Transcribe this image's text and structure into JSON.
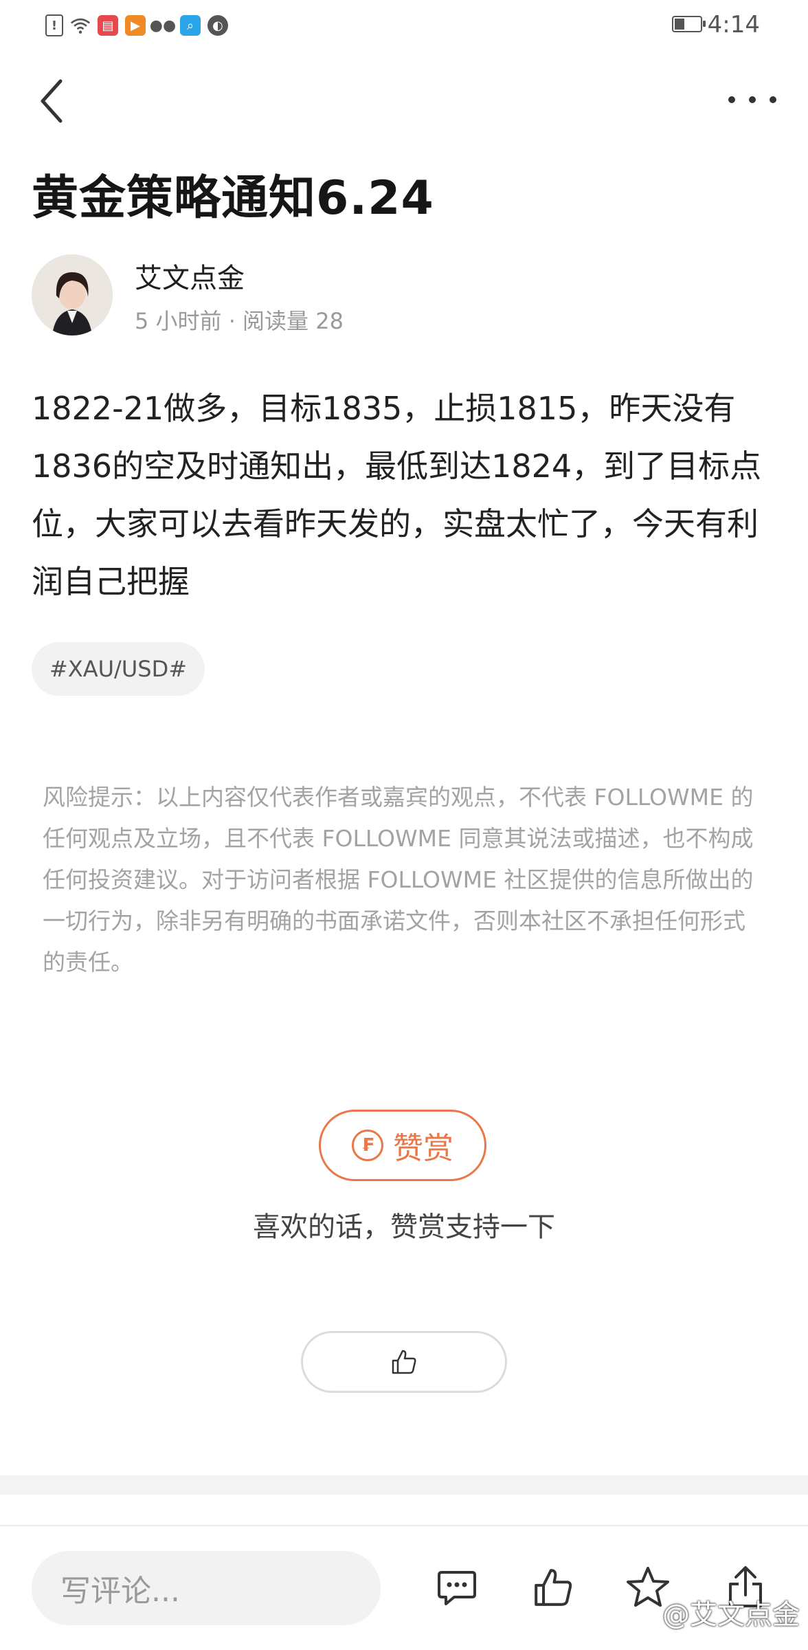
{
  "status_bar": {
    "time": "4:14",
    "icons": [
      "sim-alert-icon",
      "wifi-icon",
      "app-red-icon",
      "video-icon",
      "wechat-icon",
      "search-app-icon",
      "browser-icon"
    ]
  },
  "nav": {
    "back_icon": "chevron-left-icon",
    "more_icon": "more-dots-icon"
  },
  "article": {
    "title": "黄金策略通知6.24",
    "author": {
      "name": "艾文点金",
      "meta": "5 小时前 · 阅读量 28"
    },
    "body": "1822-21做多，目标1835，止损1815，昨天没有1836的空及时通知出，最低到达1824，到了目标点位，大家可以去看昨天发的，实盘太忙了，今天有利润自己把握",
    "tag": "#XAU/USD#",
    "disclaimer": "风险提示：以上内容仅代表作者或嘉宾的观点，不代表 FOLLOWME 的任何观点及立场，且不代表 FOLLOWME 同意其说法或描述，也不构成任何投资建议。对于访问者根据 FOLLOWME 社区提供的信息所做出的一切行为，除非另有明确的书面承诺文件，否则本社区不承担任何形式的责任。"
  },
  "reward": {
    "button_label": "赞赏",
    "coin_symbol": "₣",
    "prompt": "喜欢的话，赞赏支持一下"
  },
  "bottom_bar": {
    "comment_placeholder": "写评论..."
  },
  "watermark": "@艾文点金",
  "colors": {
    "accent": "#e8774a",
    "text": "#222222",
    "muted": "#9a9a9a"
  }
}
